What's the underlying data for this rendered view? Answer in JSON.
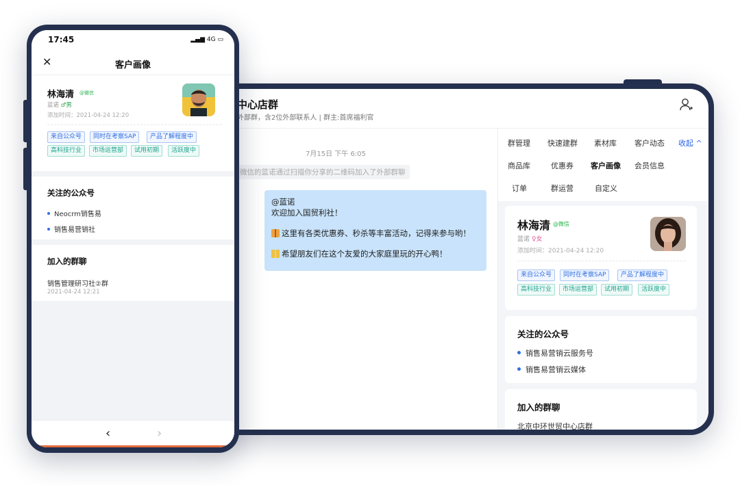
{
  "tablet": {
    "title": "中心店群",
    "subtitle": "外部群，含2位外部联系人 | 群主:首席福利官",
    "chat": {
      "time": "7月15日 下午 6:05",
      "system_msg": "微信的蓝诺通过扫描你分享的二维码加入了外部群聊",
      "bubble": {
        "mention": "@蓝诺",
        "line1": "欢迎加入国贸利社！",
        "line2": "这里有各类优惠券、秒杀等丰富活动，记得来参与哟！",
        "line3": "希望朋友们在这个友爱的大家庭里玩的开心鸭！"
      }
    },
    "tabs": {
      "row1": [
        "群管理",
        "快速建群",
        "素材库",
        "客户动态"
      ],
      "collapse": "收起",
      "row2": [
        "商品库",
        "优惠券",
        "客户画像",
        "会员信息"
      ],
      "row3": [
        "订单",
        "群运营",
        "自定义"
      ],
      "active": "客户画像"
    },
    "profile": {
      "name": "林海清",
      "wechat": "@微信",
      "nickname": "蓝诺",
      "sex": "女",
      "added": "添加时间：2021-04-24 12:20",
      "tags_row1": [
        "来自公众号",
        "同时在考察SAP",
        "产品了解程度中"
      ],
      "tags_row2": [
        "高科技行业",
        "市场运营部",
        "试用初期",
        "活跃度中"
      ]
    },
    "followed": {
      "title": "关注的公众号",
      "items": [
        "销售易营销云服务号",
        "销售易营销云媒体"
      ]
    },
    "groups": {
      "title": "加入的群聊",
      "item": "北京中环世贸中心店群"
    }
  },
  "phone": {
    "status_time": "17:45",
    "signal": "4G",
    "nav_title": "客户画像",
    "profile": {
      "name": "林海清",
      "wechat": "@微信",
      "nickname": "蓝诺",
      "sex": "男",
      "added": "添加时间：2021-04-24 12:20",
      "tags_row1": [
        "来自公众号",
        "同时在考察SAP",
        "产品了解程度中"
      ],
      "tags_row2": [
        "高科技行业",
        "市场运营部",
        "试用初期",
        "活跃度中"
      ]
    },
    "followed": {
      "title": "关注的公众号",
      "items": [
        "Neocrm销售易",
        "销售易营销社"
      ]
    },
    "groups": {
      "title": "加入的群聊",
      "item": "销售管理研习社②群",
      "date": "2021-04-24 12:21"
    }
  },
  "colors": {
    "device_frame": "#24304e",
    "bubble": "#c8e3fb",
    "accent_blue": "#2a64e8",
    "wechat_green": "#27b34a"
  }
}
